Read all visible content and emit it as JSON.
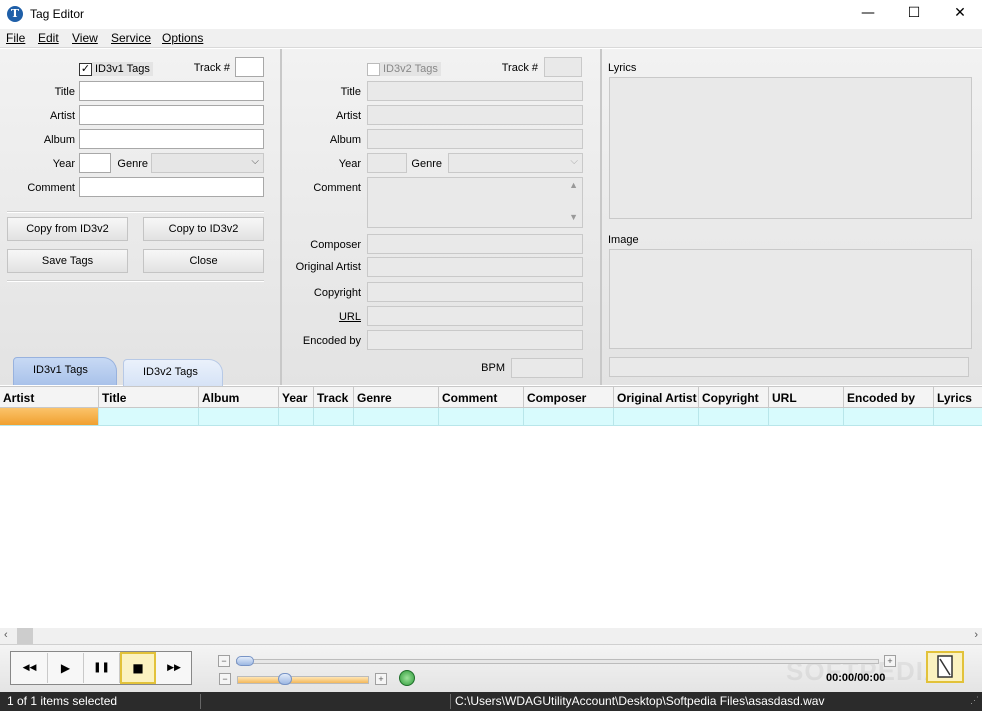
{
  "window": {
    "title": "Tag Editor",
    "app_icon_glyph": "T",
    "minimize_glyph": "—",
    "maximize_glyph": "☐",
    "close_glyph": "✕"
  },
  "menu": [
    "File",
    "Edit",
    "View",
    "Service",
    "Options"
  ],
  "id3v1": {
    "checkbox_label": "ID3v1 Tags",
    "checked": true,
    "track_label": "Track #",
    "title_label": "Title",
    "artist_label": "Artist",
    "album_label": "Album",
    "year_label": "Year",
    "genre_label": "Genre",
    "comment_label": "Comment",
    "copy_from_label": "Copy from ID3v2",
    "copy_to_label": "Copy to ID3v2",
    "save_label": "Save Tags",
    "close_label": "Close"
  },
  "id3v2": {
    "checkbox_label": "ID3v2 Tags",
    "checked": false,
    "track_label": "Track #",
    "title_label": "Title",
    "artist_label": "Artist",
    "album_label": "Album",
    "year_label": "Year",
    "genre_label": "Genre",
    "comment_label": "Comment",
    "composer_label": "Composer",
    "original_artist_label": "Original Artist",
    "copyright_label": "Copyright",
    "url_label": "URL",
    "encoded_by_label": "Encoded by",
    "bpm_label": "BPM"
  },
  "right_panel": {
    "lyrics_label": "Lyrics",
    "image_label": "Image"
  },
  "tabs": [
    "ID3v1 Tags",
    "ID3v2 Tags"
  ],
  "grid": {
    "columns": [
      "Artist",
      "Title",
      "Album",
      "Year",
      "Track",
      "Genre",
      "Comment",
      "Composer",
      "Original Artist",
      "Copyright",
      "URL",
      "Encoded by",
      "Lyrics"
    ]
  },
  "player": {
    "time": "00:00/00:00",
    "watermark": "SOFTPEDIA",
    "rewind_glyph": "◀◀",
    "play_glyph": "▶",
    "pause_glyph": "❚❚",
    "stop_glyph": "■",
    "forward_glyph": "▶▶",
    "plus_glyph": "+",
    "minus_glyph": "−"
  },
  "status": {
    "selection": "1 of 1 items selected",
    "path": "C:\\Users\\WDAGUtilityAccount\\Desktop\\Softpedia Files\\asasdasd.wav"
  },
  "colors": {
    "tab_active": "#a9c2ea",
    "grid_row": "#d8fbfd",
    "grid_row_selected_cell": "#f5a93a",
    "status_bar": "#2b2b2b"
  }
}
